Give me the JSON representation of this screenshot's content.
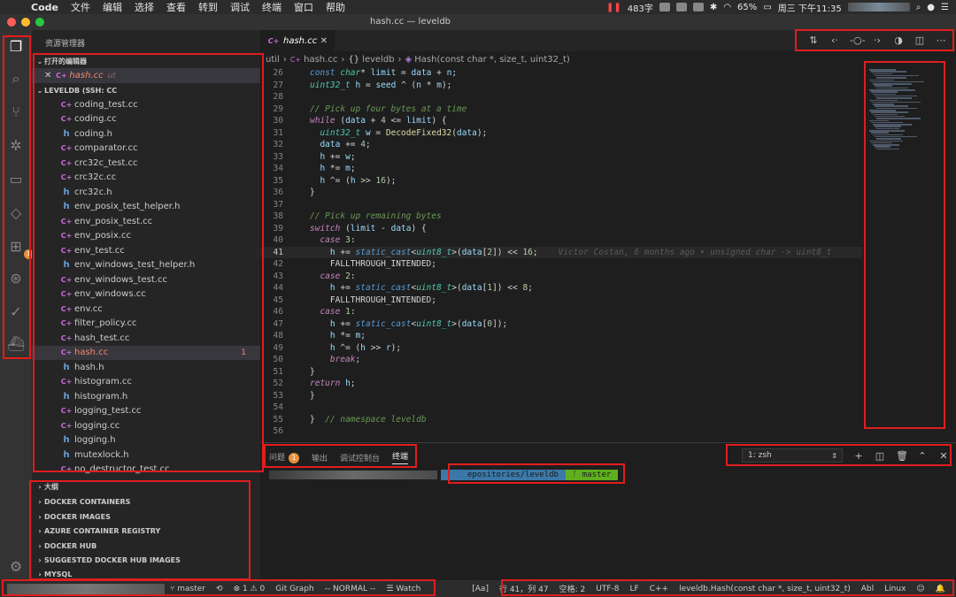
{
  "menubar": {
    "app_name": "Code",
    "items": [
      "文件",
      "编辑",
      "选择",
      "查看",
      "转到",
      "调试",
      "终端",
      "窗口",
      "帮助"
    ],
    "word_count": "483字",
    "battery": "65%",
    "clock": "周三 下午11:35"
  },
  "window": {
    "title": "hash.cc — leveldb"
  },
  "sidebar": {
    "title": "资源管理器",
    "open_editors_label": "打开的编辑器",
    "open_editor_file": "hash.cc",
    "open_editor_dir": "ut",
    "folder_label": "LEVELDB (SSH: CC",
    "files": [
      {
        "name": "coding_test.cc",
        "type": "cc"
      },
      {
        "name": "coding.cc",
        "type": "cc"
      },
      {
        "name": "coding.h",
        "type": "h"
      },
      {
        "name": "comparator.cc",
        "type": "cc"
      },
      {
        "name": "crc32c_test.cc",
        "type": "cc"
      },
      {
        "name": "crc32c.cc",
        "type": "cc"
      },
      {
        "name": "crc32c.h",
        "type": "h"
      },
      {
        "name": "env_posix_test_helper.h",
        "type": "h"
      },
      {
        "name": "env_posix_test.cc",
        "type": "cc"
      },
      {
        "name": "env_posix.cc",
        "type": "cc"
      },
      {
        "name": "env_test.cc",
        "type": "cc"
      },
      {
        "name": "env_windows_test_helper.h",
        "type": "h"
      },
      {
        "name": "env_windows_test.cc",
        "type": "cc"
      },
      {
        "name": "env_windows.cc",
        "type": "cc"
      },
      {
        "name": "env.cc",
        "type": "cc"
      },
      {
        "name": "filter_policy.cc",
        "type": "cc"
      },
      {
        "name": "hash_test.cc",
        "type": "cc"
      },
      {
        "name": "hash.cc",
        "type": "cc",
        "badge": "1"
      },
      {
        "name": "hash.h",
        "type": "h"
      },
      {
        "name": "histogram.cc",
        "type": "cc"
      },
      {
        "name": "histogram.h",
        "type": "h"
      },
      {
        "name": "logging_test.cc",
        "type": "cc"
      },
      {
        "name": "logging.cc",
        "type": "cc"
      },
      {
        "name": "logging.h",
        "type": "h"
      },
      {
        "name": "mutexlock.h",
        "type": "h"
      },
      {
        "name": "no_destructor_test.cc",
        "type": "cc"
      }
    ],
    "bottom_sections": [
      "大纲",
      "DOCKER CONTAINERS",
      "DOCKER IMAGES",
      "AZURE CONTAINER REGISTRY",
      "DOCKER HUB",
      "SUGGESTED DOCKER HUB IMAGES",
      "MYSQL"
    ]
  },
  "activity_badge": "1",
  "editor": {
    "tab_label": "hash.cc",
    "breadcrumb": {
      "folder": "util",
      "file": "hash.cc",
      "namespace": "leveldb",
      "function": "Hash(const char *, size_t, uint32_t)"
    },
    "blame": "Victor Costan, 6 months ago • unsigned char -> uint8_t",
    "line_numbers": [
      "26",
      "27",
      "28",
      "29",
      "30",
      "31",
      "32",
      "33",
      "34",
      "35",
      "36",
      "37",
      "38",
      "39",
      "40",
      "41",
      "42",
      "43",
      "44",
      "45",
      "46",
      "47",
      "48",
      "49",
      "50",
      "51",
      "52",
      "53",
      "54",
      "55",
      "56"
    ],
    "current_line": "41"
  },
  "panel": {
    "tabs": [
      "问题",
      "输出",
      "调试控制台",
      "终端"
    ],
    "problems_badge": "1",
    "terminal_select": "1: zsh",
    "prompt_path": "epositories/leveldb",
    "prompt_branch": "master"
  },
  "statusbar": {
    "branch": "master",
    "problems": "⊗ 1 ⚠ 0",
    "git_graph": "Git Graph",
    "vim_mode": "-- NORMAL --",
    "watch": "Watch",
    "case": "[Aa]",
    "position": "行 41，列 47",
    "indent": "空格: 2",
    "encoding": "UTF-8",
    "eol": "LF",
    "language": "C++",
    "symbol": "leveldb.Hash(const char *, size_t, uint32_t)",
    "abl": "Abl",
    "os": "Linux"
  },
  "colors": {
    "accent": "#007acc",
    "highlight": "#e11d1d",
    "badge": "#e8913a",
    "error": "#f48771"
  }
}
